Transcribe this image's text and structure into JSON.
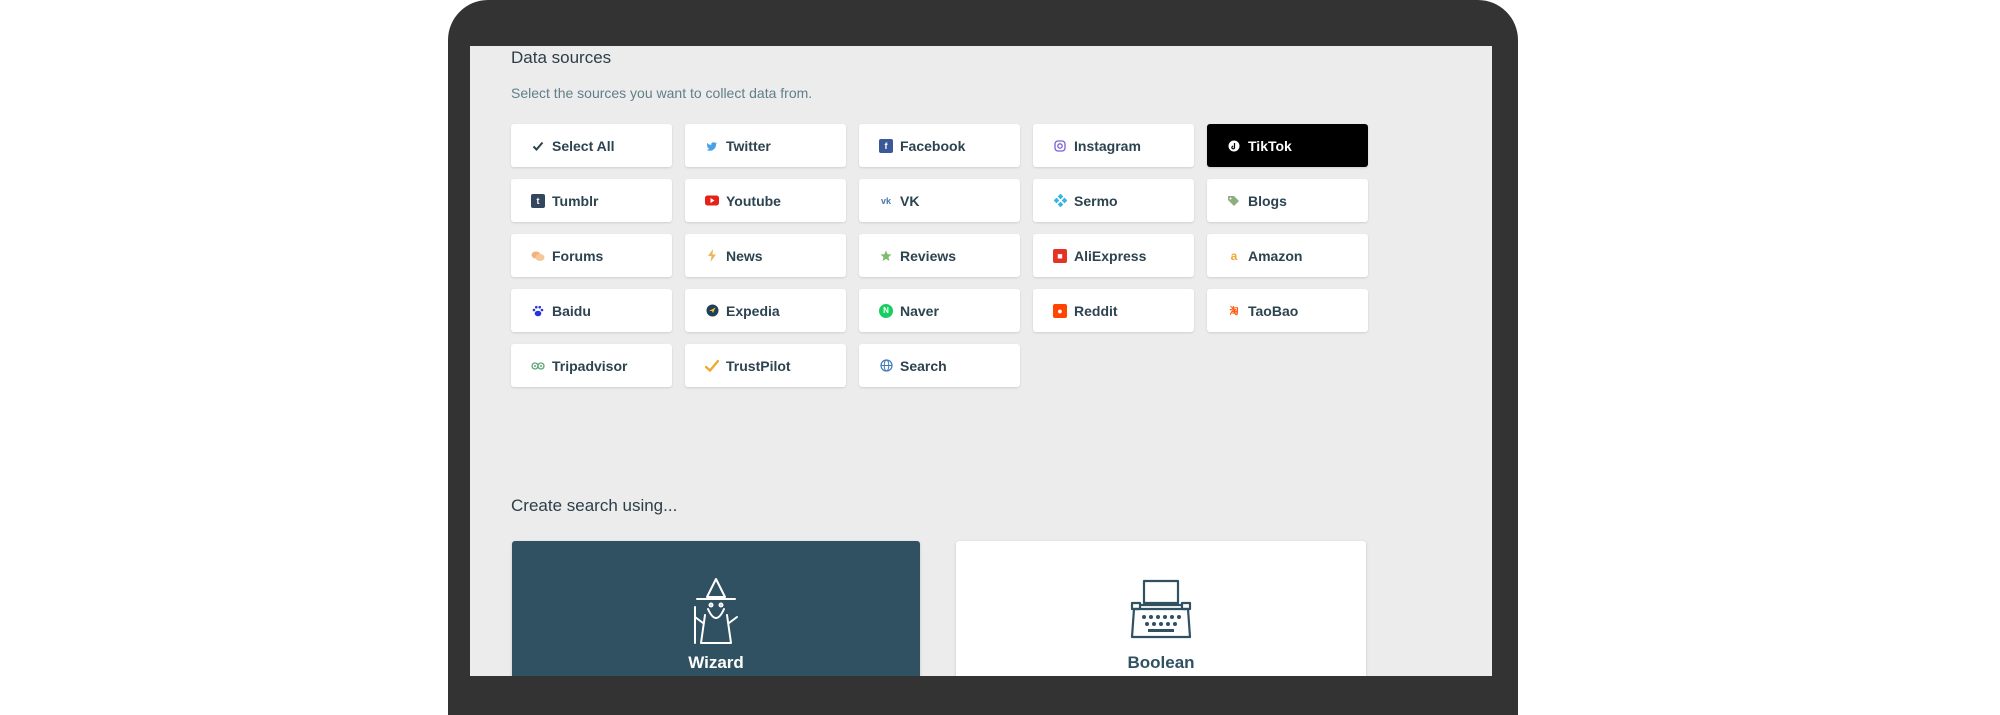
{
  "data_sources": {
    "title": "Data sources",
    "subtitle": "Select the sources you want to collect data from.",
    "items": [
      {
        "label": "Select All",
        "icon": "check-icon",
        "selected": false
      },
      {
        "label": "Twitter",
        "icon": "twitter-icon",
        "selected": false
      },
      {
        "label": "Facebook",
        "icon": "facebook-icon",
        "selected": false
      },
      {
        "label": "Instagram",
        "icon": "instagram-icon",
        "selected": false
      },
      {
        "label": "TikTok",
        "icon": "tiktok-icon",
        "selected": true
      },
      {
        "label": "Tumblr",
        "icon": "tumblr-icon",
        "selected": false
      },
      {
        "label": "Youtube",
        "icon": "youtube-icon",
        "selected": false
      },
      {
        "label": "VK",
        "icon": "vk-icon",
        "selected": false
      },
      {
        "label": "Sermo",
        "icon": "sermo-icon",
        "selected": false
      },
      {
        "label": "Blogs",
        "icon": "tag-icon",
        "selected": false
      },
      {
        "label": "Forums",
        "icon": "chat-bubbles-icon",
        "selected": false
      },
      {
        "label": "News",
        "icon": "bolt-icon",
        "selected": false
      },
      {
        "label": "Reviews",
        "icon": "star-icon",
        "selected": false
      },
      {
        "label": "AliExpress",
        "icon": "aliexpress-icon",
        "selected": false
      },
      {
        "label": "Amazon",
        "icon": "amazon-icon",
        "selected": false
      },
      {
        "label": "Baidu",
        "icon": "baidu-paw-icon",
        "selected": false
      },
      {
        "label": "Expedia",
        "icon": "expedia-icon",
        "selected": false
      },
      {
        "label": "Naver",
        "icon": "naver-icon",
        "selected": false
      },
      {
        "label": "Reddit",
        "icon": "reddit-icon",
        "selected": false
      },
      {
        "label": "TaoBao",
        "icon": "taobao-icon",
        "selected": false
      },
      {
        "label": "Tripadvisor",
        "icon": "tripadvisor-owl-icon",
        "selected": false
      },
      {
        "label": "TrustPilot",
        "icon": "checkmark-icon",
        "selected": false
      },
      {
        "label": "Search",
        "icon": "globe-icon",
        "selected": false
      }
    ]
  },
  "create_search": {
    "title": "Create search using...",
    "wizard": {
      "label": "Wizard",
      "icon": "wizard-icon"
    },
    "boolean": {
      "label": "Boolean",
      "icon": "typewriter-icon"
    }
  },
  "colors": {
    "screen_background": "#ececec",
    "laptop_frame": "#333333",
    "selected_button": "#000000",
    "wizard_card": "#2f5162",
    "text_dark": "#2c4350",
    "subtitle_text": "#5f7f8a"
  }
}
